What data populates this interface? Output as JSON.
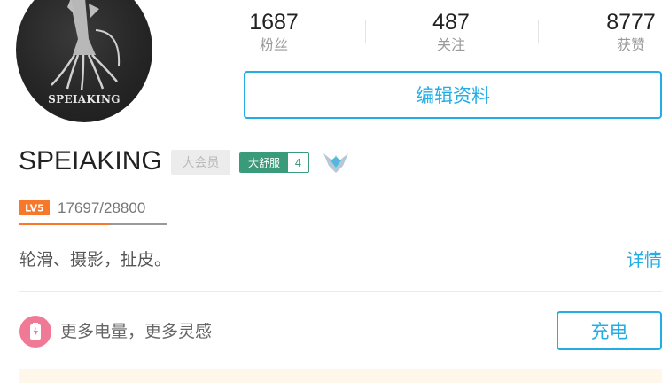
{
  "avatar": {
    "text": "SPEIAKING"
  },
  "stats": {
    "followers": {
      "value": "1687",
      "label": "粉丝"
    },
    "following": {
      "value": "487",
      "label": "关注"
    },
    "likes": {
      "value": "8777",
      "label": "获赞"
    }
  },
  "edit_button_label": "编辑资料",
  "profile": {
    "username": "SPEIAKING",
    "vip_label": "大会员",
    "medal": {
      "name": "大舒服",
      "level": "4"
    }
  },
  "level": {
    "badge": "LV5",
    "exp_text": "17697/28800",
    "exp_fraction": 0.6145
  },
  "bio": "轮滑、摄影，扯皮。",
  "details_label": "详情",
  "charge": {
    "text": "更多电量，更多灵感",
    "button_label": "充电"
  },
  "colors": {
    "accent": "#23ade5",
    "level_orange": "#f7782b",
    "medal_green": "#3a9b7a",
    "charge_pink": "#f07a96"
  }
}
